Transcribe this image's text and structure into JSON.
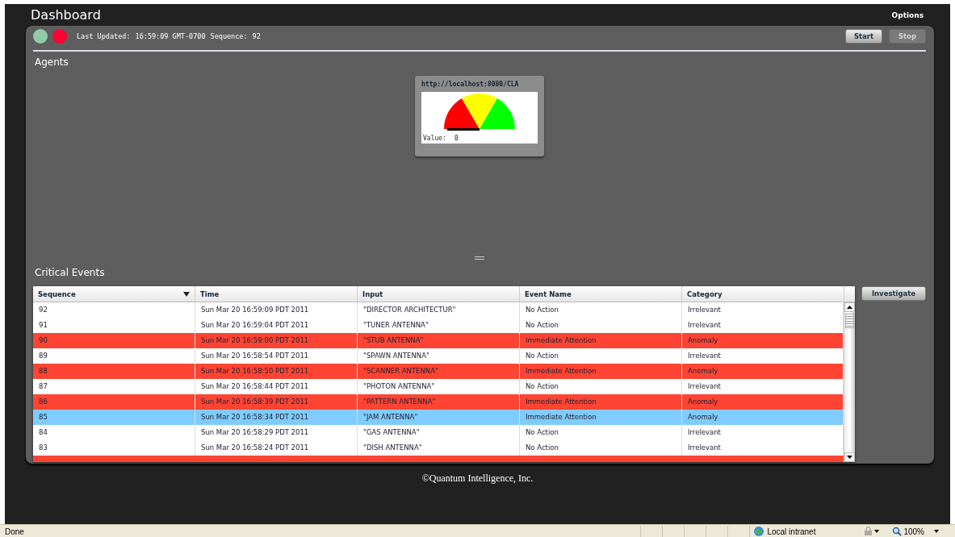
{
  "header": {
    "title": "Dashboard",
    "options": "Options"
  },
  "toolbar": {
    "indicators": [
      {
        "color": "#90cca8"
      },
      {
        "color": "#ff0033"
      }
    ],
    "last_updated_label": "Last Updated:",
    "last_updated": "16:59:09 GMT-0700",
    "sequence_label": "Sequence:",
    "sequence": "92",
    "buttons": [
      {
        "label": "Start",
        "disabled": false
      },
      {
        "label": "Stop",
        "disabled": true
      }
    ]
  },
  "agents": {
    "title": "Agents",
    "cards": [
      {
        "url": "http://localhost:8080/CLA",
        "value_label": "Value:",
        "value": "0"
      }
    ]
  },
  "critical_events": {
    "title": "Critical Events",
    "investigate": "Investigate",
    "columns": [
      {
        "label": "Sequence",
        "sorted": true
      },
      {
        "label": "Time",
        "sorted": false
      },
      {
        "label": "Input",
        "sorted": false
      },
      {
        "label": "Event Name",
        "sorted": false
      },
      {
        "label": "Category",
        "sorted": false
      }
    ],
    "rows": [
      {
        "cells": [
          "92",
          "Sun Mar 20 16:59:09 PDT 2011",
          "\"DIRECTOR ARCHITECTUR\"",
          "No Action",
          "Irrelevant"
        ],
        "alert": false,
        "selected": false
      },
      {
        "cells": [
          "91",
          "Sun Mar 20 16:59:04 PDT 2011",
          "\"TUNER ANTENNA\"",
          "No Action",
          "Irrelevant"
        ],
        "alert": false,
        "selected": false
      },
      {
        "cells": [
          "90",
          "Sun Mar 20 16:59:00 PDT 2011",
          "\"STUB ANTENNA\"",
          "Immediate Attention",
          "Anomaly"
        ],
        "alert": true,
        "selected": false
      },
      {
        "cells": [
          "89",
          "Sun Mar 20 16:58:54 PDT 2011",
          "\"SPAWN ANTENNA\"",
          "No Action",
          "Irrelevant"
        ],
        "alert": false,
        "selected": false
      },
      {
        "cells": [
          "88",
          "Sun Mar 20 16:58:50 PDT 2011",
          "\"SCANNER ANTENNA\"",
          "Immediate Attention",
          "Anomaly"
        ],
        "alert": true,
        "selected": false
      },
      {
        "cells": [
          "87",
          "Sun Mar 20 16:58:44 PDT 2011",
          "\"PHOTON ANTENNA\"",
          "No Action",
          "Irrelevant"
        ],
        "alert": false,
        "selected": false
      },
      {
        "cells": [
          "86",
          "Sun Mar 20 16:58:39 PDT 2011",
          "\"PATTERN ANTENNA\"",
          "Immediate Attention",
          "Anomaly"
        ],
        "alert": true,
        "selected": false
      },
      {
        "cells": [
          "85",
          "Sun Mar 20 16:58:34 PDT 2011",
          "\"JAM ANTENNA\"",
          "Immediate Attention",
          "Anomaly"
        ],
        "selected": true
      },
      {
        "cells": [
          "84",
          "Sun Mar 20 16:58:29 PDT 2011",
          "\"GAS ANTENNA\"",
          "No Action",
          "Irrelevant"
        ],
        "alert": false,
        "selected": false
      },
      {
        "cells": [
          "83",
          "Sun Mar 20 16:58:24 PDT 2011",
          "\"DISH ANTENNA\"",
          "No Action",
          "Irrelevant"
        ],
        "alert": false,
        "selected": false
      },
      {
        "cells": [],
        "alert": true,
        "selected": false
      }
    ]
  },
  "footer": "©Quantum Intelligence, Inc.",
  "status_bar": {
    "status": "Done",
    "zone": "Local intranet",
    "zoom": "100%"
  }
}
